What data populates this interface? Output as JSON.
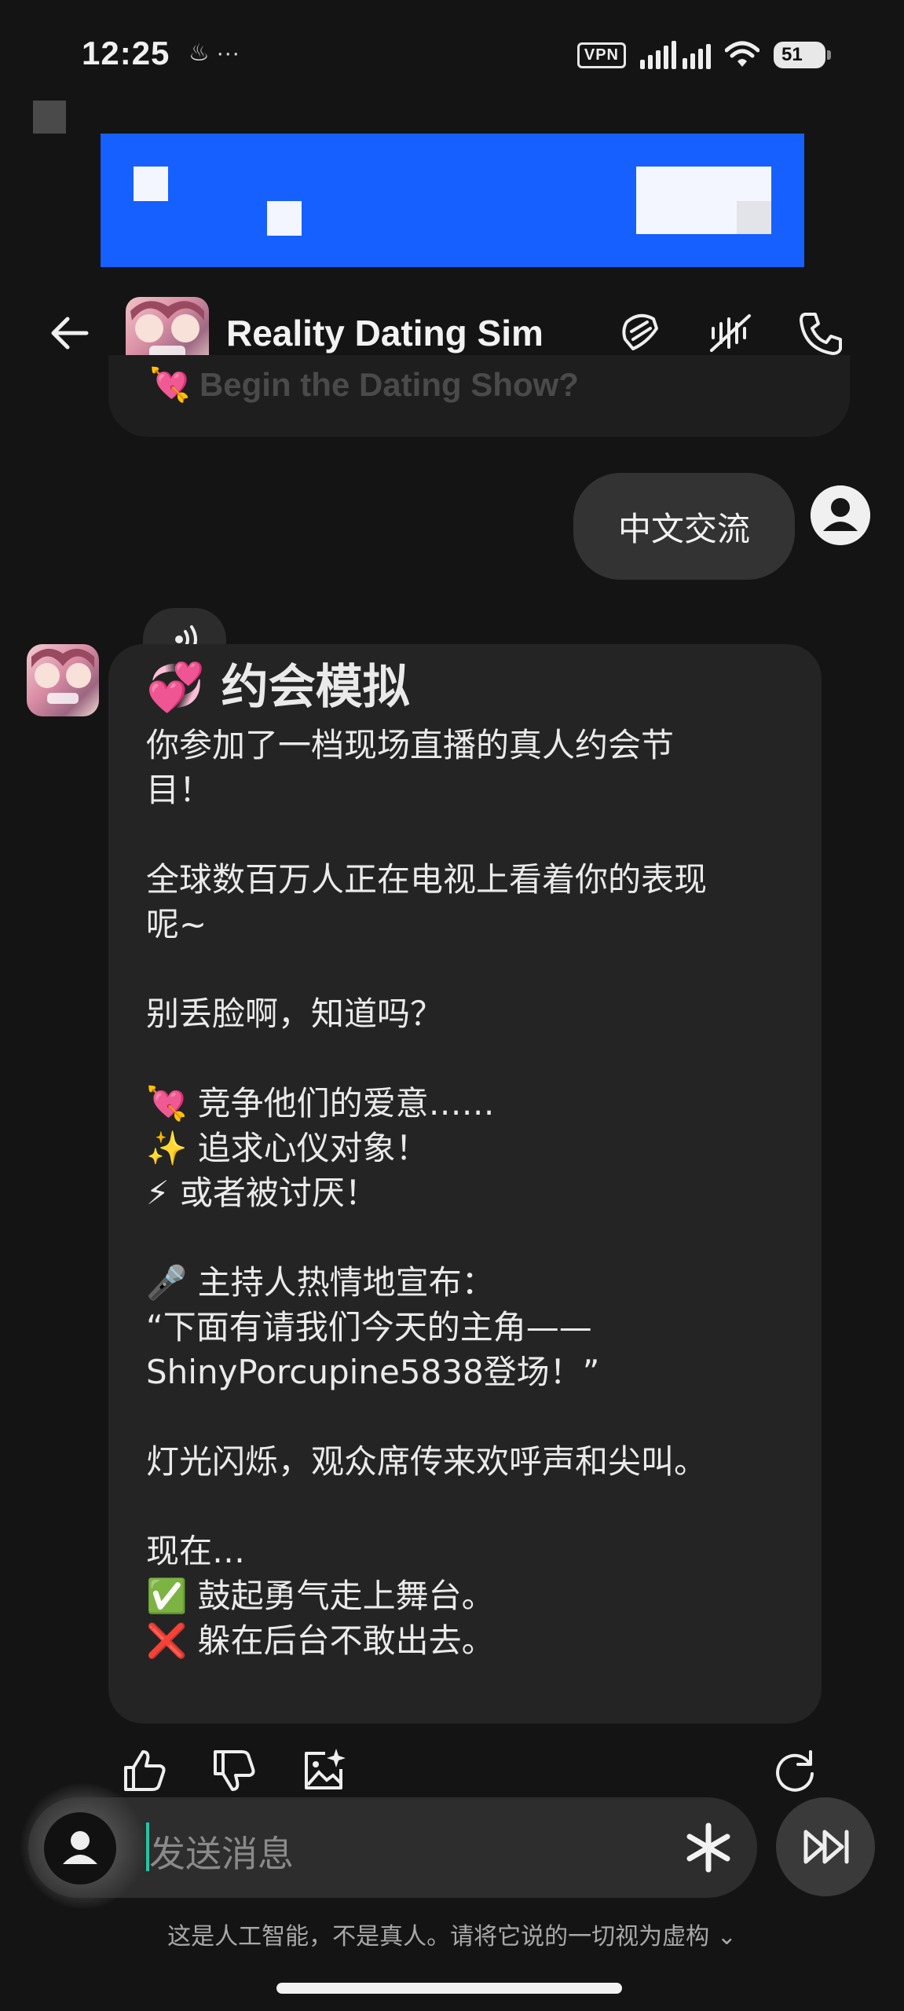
{
  "status": {
    "time": "12:25",
    "left_icons": "♨ ···",
    "vpn": "VPN",
    "battery": "51"
  },
  "header": {
    "title": "Reality Dating Sim"
  },
  "faded_prev": "💘 Begin the Dating Show?",
  "user_message": "中文交流",
  "bot_message": {
    "title": "💞 约会模拟",
    "lines": [
      "你参加了一档现场直播的真人约会节",
      "目！",
      "",
      "全球数百万人正在电视上看着你的表现",
      "呢~",
      "",
      "别丢脸啊，知道吗？",
      "",
      "💘 竞争他们的爱意……",
      "✨ 追求心仪对象！",
      "⚡ 或者被讨厌！",
      "",
      "🎤 主持人热情地宣布：",
      "“下面有请我们今天的主角——",
      "ShinyPorcupine5838登场！”",
      "",
      "灯光闪烁，观众席传来欢呼声和尖叫。",
      "",
      "现在…",
      "✅ 鼓起勇气走上舞台。",
      "❌ 躲在后台不敢出去。"
    ]
  },
  "input": {
    "placeholder": "发送消息"
  },
  "disclaimer": "这是人工智能，不是真人。请将它说的一切视为虚构 ⌄",
  "icons": {
    "back": "arrow-left-icon",
    "header_right": [
      "sticker-icon",
      "mute-voice-icon",
      "phone-call-icon"
    ],
    "actions": [
      "thumbs-up-icon",
      "thumbs-down-icon",
      "image-sparkle-icon",
      "regenerate-icon"
    ]
  },
  "colors": {
    "banner": "#1660ff",
    "background": "#141414",
    "bubble": "#242424",
    "caret": "#27c3a5"
  }
}
